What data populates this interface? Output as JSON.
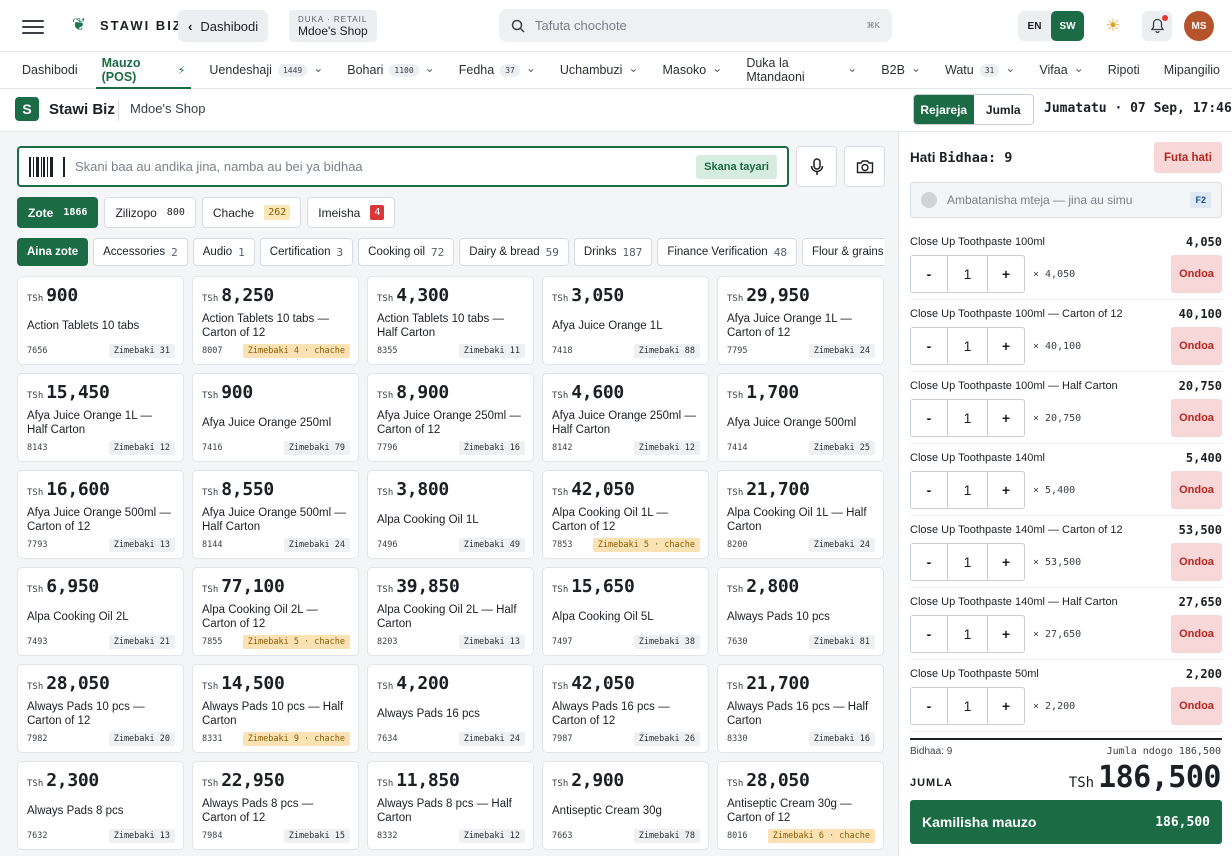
{
  "topbar": {
    "brand": "STAWI BIZ",
    "back_label": "Dashibodi",
    "shop_kicker": "DUKA · RETAIL",
    "shop_name": "Mdoe's Shop",
    "search_placeholder": "Tafuta chochote",
    "search_shortcut": "⌘K",
    "lang_en": "EN",
    "lang_sw": "SW",
    "avatar": "MS"
  },
  "nav": [
    {
      "label": "Dashibodi",
      "count": "",
      "chevron": false,
      "active": false
    },
    {
      "label": "Mauzo (POS)",
      "count": "",
      "chevron": false,
      "active": true,
      "bolt": "⚡"
    },
    {
      "label": "Uendeshaji",
      "count": "1449",
      "chevron": true,
      "active": false
    },
    {
      "label": "Bohari",
      "count": "1100",
      "chevron": true,
      "active": false
    },
    {
      "label": "Fedha",
      "count": "37",
      "chevron": true,
      "active": false
    },
    {
      "label": "Uchambuzi",
      "count": "",
      "chevron": true,
      "active": false
    },
    {
      "label": "Masoko",
      "count": "",
      "chevron": true,
      "active": false
    },
    {
      "label": "Duka la Mtandaoni",
      "count": "",
      "chevron": true,
      "active": false
    },
    {
      "label": "B2B",
      "count": "",
      "chevron": true,
      "active": false
    },
    {
      "label": "Watu",
      "count": "31",
      "chevron": true,
      "active": false
    },
    {
      "label": "Vifaa",
      "count": "",
      "chevron": true,
      "active": false
    },
    {
      "label": "Ripoti",
      "count": "",
      "chevron": false,
      "active": false
    },
    {
      "label": "Mipangilio",
      "count": "",
      "chevron": false,
      "active": false
    }
  ],
  "subheader": {
    "logo_letter": "S",
    "brand": "Stawi Biz",
    "shop": "Mdoe's Shop",
    "mode_retail": "Rejareja",
    "mode_wholesale": "Jumla",
    "datetime": "Jumatatu · 07 Sep, 17:46"
  },
  "scan": {
    "placeholder": "Skani baa au andika jina, namba au bei ya bidhaa",
    "ready": "Skana tayari"
  },
  "stock_filters": [
    {
      "label": "Zote",
      "count": "1866",
      "style": "on"
    },
    {
      "label": "Zilizopo",
      "count": "800",
      "style": ""
    },
    {
      "label": "Chache",
      "count": "262",
      "style": "warn"
    },
    {
      "label": "Imeisha",
      "count": "4",
      "style": "err"
    }
  ],
  "categories": [
    {
      "label": "Aina zote",
      "count": "",
      "active": true
    },
    {
      "label": "Accessories",
      "count": "2",
      "active": false
    },
    {
      "label": "Audio",
      "count": "1",
      "active": false
    },
    {
      "label": "Certification",
      "count": "3",
      "active": false
    },
    {
      "label": "Cooking oil",
      "count": "72",
      "active": false
    },
    {
      "label": "Dairy & bread",
      "count": "59",
      "active": false
    },
    {
      "label": "Drinks",
      "count": "187",
      "active": false
    },
    {
      "label": "Finance Verification",
      "count": "48",
      "active": false
    },
    {
      "label": "Flour & grains",
      "count": "",
      "active": false
    }
  ],
  "currency": "TSh",
  "products": [
    {
      "price": "900",
      "name": "Action Tablets 10 tabs",
      "code": "7656",
      "stock": "Zimebaki 31",
      "low": false
    },
    {
      "price": "8,250",
      "name": "Action Tablets 10 tabs — Carton of 12",
      "code": "8007",
      "stock": "Zimebaki 4 · chache",
      "low": true
    },
    {
      "price": "4,300",
      "name": "Action Tablets 10 tabs — Half Carton",
      "code": "8355",
      "stock": "Zimebaki 11",
      "low": false
    },
    {
      "price": "3,050",
      "name": "Afya Juice Orange 1L",
      "code": "7418",
      "stock": "Zimebaki 88",
      "low": false
    },
    {
      "price": "29,950",
      "name": "Afya Juice Orange 1L — Carton of 12",
      "code": "7795",
      "stock": "Zimebaki 24",
      "low": false
    },
    {
      "price": "15,450",
      "name": "Afya Juice Orange 1L — Half Carton",
      "code": "8143",
      "stock": "Zimebaki 12",
      "low": false
    },
    {
      "price": "900",
      "name": "Afya Juice Orange 250ml",
      "code": "7416",
      "stock": "Zimebaki 79",
      "low": false
    },
    {
      "price": "8,900",
      "name": "Afya Juice Orange 250ml — Carton of 12",
      "code": "7796",
      "stock": "Zimebaki 16",
      "low": false
    },
    {
      "price": "4,600",
      "name": "Afya Juice Orange 250ml — Half Carton",
      "code": "8142",
      "stock": "Zimebaki 12",
      "low": false
    },
    {
      "price": "1,700",
      "name": "Afya Juice Orange 500ml",
      "code": "7414",
      "stock": "Zimebaki 25",
      "low": false
    },
    {
      "price": "16,600",
      "name": "Afya Juice Orange 500ml — Carton of 12",
      "code": "7793",
      "stock": "Zimebaki 13",
      "low": false
    },
    {
      "price": "8,550",
      "name": "Afya Juice Orange 500ml — Half Carton",
      "code": "8144",
      "stock": "Zimebaki 24",
      "low": false
    },
    {
      "price": "3,800",
      "name": "Alpa Cooking Oil 1L",
      "code": "7496",
      "stock": "Zimebaki 49",
      "low": false
    },
    {
      "price": "42,050",
      "name": "Alpa Cooking Oil 1L — Carton of 12",
      "code": "7853",
      "stock": "Zimebaki 5 · chache",
      "low": true
    },
    {
      "price": "21,700",
      "name": "Alpa Cooking Oil 1L — Half Carton",
      "code": "8200",
      "stock": "Zimebaki 24",
      "low": false
    },
    {
      "price": "6,950",
      "name": "Alpa Cooking Oil 2L",
      "code": "7493",
      "stock": "Zimebaki 21",
      "low": false
    },
    {
      "price": "77,100",
      "name": "Alpa Cooking Oil 2L — Carton of 12",
      "code": "7855",
      "stock": "Zimebaki 5 · chache",
      "low": true
    },
    {
      "price": "39,850",
      "name": "Alpa Cooking Oil 2L — Half Carton",
      "code": "8203",
      "stock": "Zimebaki 13",
      "low": false
    },
    {
      "price": "15,650",
      "name": "Alpa Cooking Oil 5L",
      "code": "7497",
      "stock": "Zimebaki 38",
      "low": false
    },
    {
      "price": "2,800",
      "name": "Always Pads 10 pcs",
      "code": "7630",
      "stock": "Zimebaki 81",
      "low": false
    },
    {
      "price": "28,050",
      "name": "Always Pads 10 pcs — Carton of 12",
      "code": "7982",
      "stock": "Zimebaki 20",
      "low": false
    },
    {
      "price": "14,500",
      "name": "Always Pads 10 pcs — Half Carton",
      "code": "8331",
      "stock": "Zimebaki 9 · chache",
      "low": true
    },
    {
      "price": "4,200",
      "name": "Always Pads 16 pcs",
      "code": "7634",
      "stock": "Zimebaki 24",
      "low": false
    },
    {
      "price": "42,050",
      "name": "Always Pads 16 pcs — Carton of 12",
      "code": "7987",
      "stock": "Zimebaki 26",
      "low": false
    },
    {
      "price": "21,700",
      "name": "Always Pads 16 pcs — Half Carton",
      "code": "8330",
      "stock": "Zimebaki 16",
      "low": false
    },
    {
      "price": "2,300",
      "name": "Always Pads 8 pcs",
      "code": "7632",
      "stock": "Zimebaki 13",
      "low": false
    },
    {
      "price": "22,950",
      "name": "Always Pads 8 pcs — Carton of 12",
      "code": "7984",
      "stock": "Zimebaki 15",
      "low": false
    },
    {
      "price": "11,850",
      "name": "Always Pads 8 pcs — Half Carton",
      "code": "8332",
      "stock": "Zimebaki 12",
      "low": false
    },
    {
      "price": "2,900",
      "name": "Antiseptic Cream 30g",
      "code": "7663",
      "stock": "Zimebaki 78",
      "low": false
    },
    {
      "price": "28,050",
      "name": "Antiseptic Cream 30g — Carton of 12",
      "code": "8016",
      "stock": "Zimebaki 6 · chache",
      "low": true
    }
  ],
  "cart": {
    "title_prefix": "Hati",
    "title_count": "Bidhaa: 9",
    "clear": "Futa hati",
    "customer_placeholder": "Ambatanisha mteja — jina au simu",
    "customer_shortcut": "F2",
    "remove_label": "Ondoa",
    "items": [
      {
        "name": "Close Up Toothpaste 100ml",
        "total": "4,050",
        "qty": "1",
        "unit": "× 4,050"
      },
      {
        "name": "Close Up Toothpaste 100ml — Carton of 12",
        "total": "40,100",
        "qty": "1",
        "unit": "× 40,100"
      },
      {
        "name": "Close Up Toothpaste 100ml — Half Carton",
        "total": "20,750",
        "qty": "1",
        "unit": "× 20,750"
      },
      {
        "name": "Close Up Toothpaste 140ml",
        "total": "5,400",
        "qty": "1",
        "unit": "× 5,400"
      },
      {
        "name": "Close Up Toothpaste 140ml — Carton of 12",
        "total": "53,500",
        "qty": "1",
        "unit": "× 53,500"
      },
      {
        "name": "Close Up Toothpaste 140ml — Half Carton",
        "total": "27,650",
        "qty": "1",
        "unit": "× 27,650"
      },
      {
        "name": "Close Up Toothpaste 50ml",
        "total": "2,200",
        "qty": "1",
        "unit": "× 2,200"
      }
    ],
    "items_count": "Bidhaa: 9",
    "subtotal": "Jumla ndogo 186,500",
    "total_label": "JUMLA",
    "total_currency": "TSh",
    "total": "186,500",
    "checkout_label": "Kamilisha mauzo",
    "checkout_amount": "186,500"
  }
}
